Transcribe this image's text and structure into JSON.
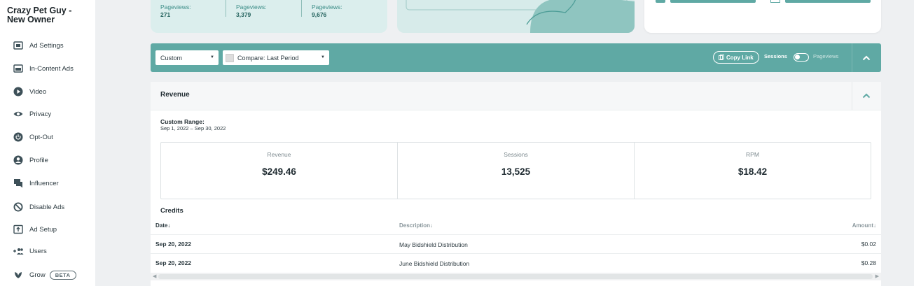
{
  "sidebar": {
    "site_title_line1": "Crazy Pet Guy -",
    "site_title_line2": "New Owner",
    "items": [
      {
        "label": "Ad Settings",
        "icon": "ad-settings-icon"
      },
      {
        "label": "In-Content Ads",
        "icon": "in-content-ads-icon"
      },
      {
        "label": "Video",
        "icon": "video-play-icon"
      },
      {
        "label": "Privacy",
        "icon": "eye-icon"
      },
      {
        "label": "Opt-Out",
        "icon": "power-icon"
      },
      {
        "label": "Profile",
        "icon": "user-icon"
      },
      {
        "label": "Influencer",
        "icon": "chat-icon"
      },
      {
        "label": "Disable Ads",
        "icon": "block-icon"
      },
      {
        "label": "Ad Setup",
        "icon": "upload-box-icon"
      },
      {
        "label": "Users",
        "icon": "users-add-icon"
      },
      {
        "label": "Grow",
        "icon": "grow-leaf-icon",
        "badge": "BETA"
      }
    ]
  },
  "top_cards": {
    "pageviews": [
      {
        "label": "Pageviews:",
        "value": "271"
      },
      {
        "label": "Pageviews:",
        "value": "3,379"
      },
      {
        "label": "Pageviews:",
        "value": "9,676"
      }
    ]
  },
  "toolbar": {
    "range_select": "Custom",
    "compare_select": "Compare: Last Period",
    "copy_link": "Copy Link",
    "toggle_left": "Sessions",
    "toggle_right": "Pageviews"
  },
  "revenue": {
    "title": "Revenue",
    "range_label": "Custom Range:",
    "range_value": "Sep 1, 2022 – Sep 30, 2022",
    "metrics": [
      {
        "label": "Revenue",
        "value": "$249.46"
      },
      {
        "label": "Sessions",
        "value": "13,525"
      },
      {
        "label": "RPM",
        "value": "$18.42"
      }
    ]
  },
  "credits": {
    "title": "Credits",
    "columns": {
      "date": "Date↓",
      "description": "Description↓",
      "amount": "Amount↓"
    },
    "rows": [
      {
        "date": "Sep 20, 2022",
        "description": "May Bidshield Distribution",
        "amount": "$0.02"
      },
      {
        "date": "Sep 20, 2022",
        "description": "June Bidshield Distribution",
        "amount": "$0.28"
      }
    ]
  },
  "colors": {
    "teal": "#5fa9a4",
    "teal_light": "#dbeeed",
    "sidebar_icon": "#3d5058"
  }
}
